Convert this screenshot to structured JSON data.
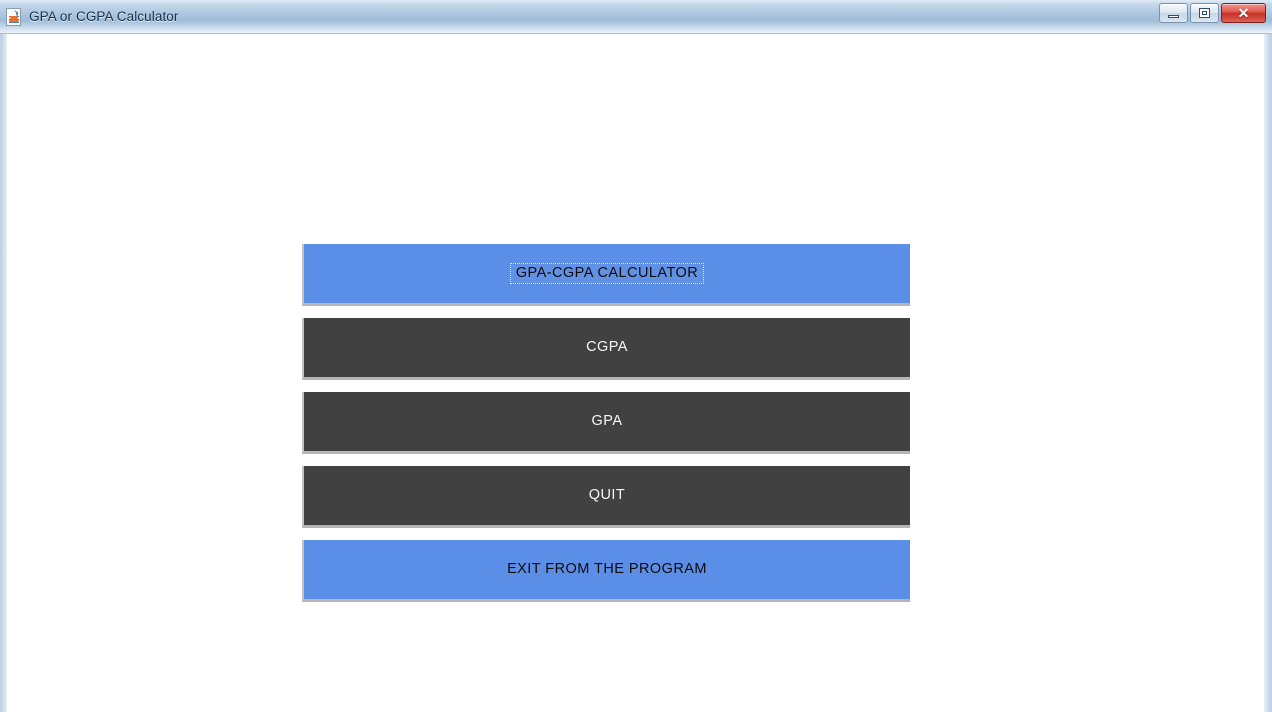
{
  "window": {
    "title": "GPA or CGPA Calculator",
    "icon": "java-application-icon",
    "controls": {
      "minimize_label": "–",
      "maximize_label": "□",
      "close_label": "✕"
    }
  },
  "colors": {
    "blue_button": "#5b8ee6",
    "dark_button": "#414141",
    "blue_button_text": "#0c0c0c",
    "dark_button_text": "#f6f6f6",
    "title_bar_text": "#16304e",
    "close_button": "#c32f22",
    "content_background": "#ffffff"
  },
  "main": {
    "buttons": [
      {
        "id": "title-banner",
        "label": "GPA-CGPA CALCULATOR",
        "style": "blue",
        "focused": true
      },
      {
        "id": "cgpa",
        "label": "CGPA",
        "style": "dark",
        "focused": false
      },
      {
        "id": "gpa",
        "label": "GPA",
        "style": "dark",
        "focused": false
      },
      {
        "id": "quit",
        "label": "QUIT",
        "style": "dark",
        "focused": false
      },
      {
        "id": "exit-from-program",
        "label": "EXIT FROM THE PROGRAM",
        "style": "blue",
        "focused": false
      }
    ]
  }
}
